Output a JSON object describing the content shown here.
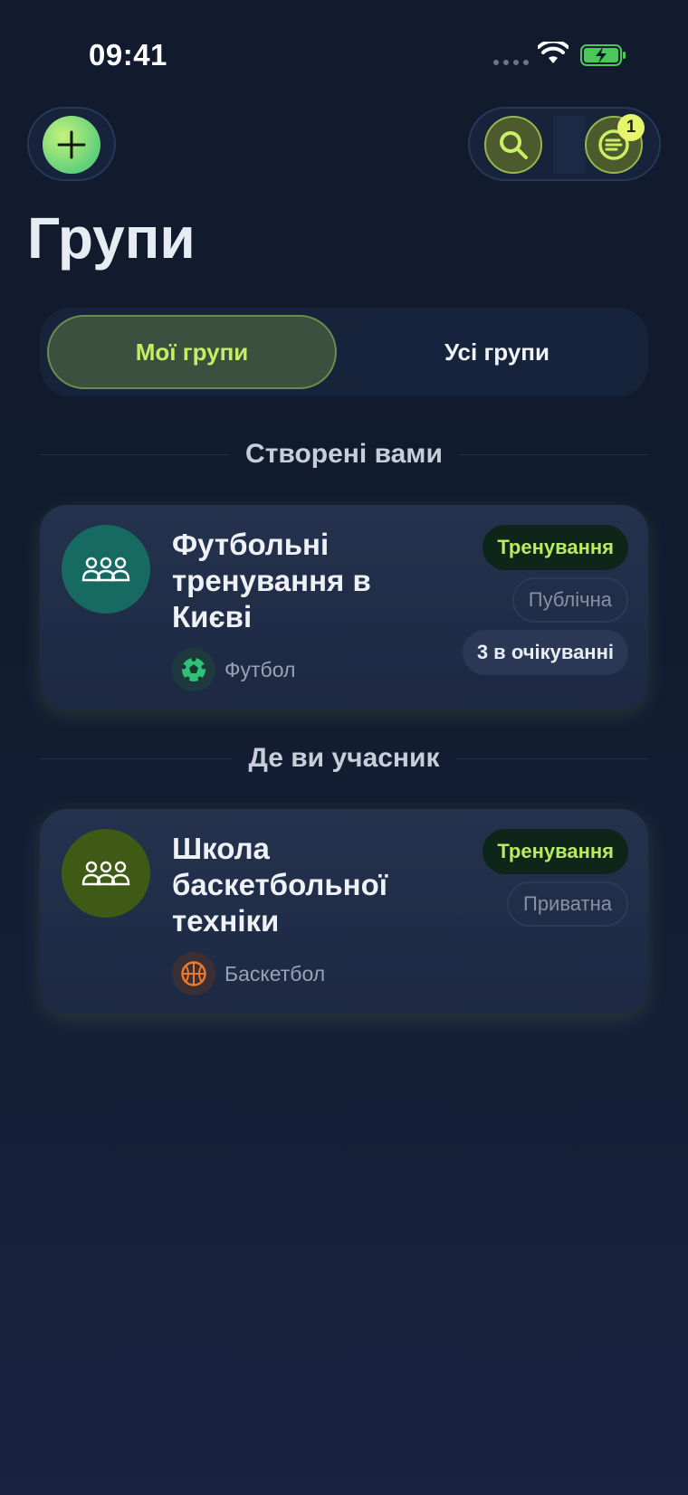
{
  "status_bar": {
    "time": "09:41"
  },
  "header": {
    "title": "Групи",
    "badge_count": "1"
  },
  "tabs": [
    {
      "label": "Мої групи",
      "active": true
    },
    {
      "label": "Усі групи",
      "active": false
    }
  ],
  "sections": [
    {
      "heading": "Створені вами",
      "card": {
        "title": "Футбольні тренування в Києві",
        "sport": "Футбол",
        "tags": {
          "type": "Тренування",
          "privacy": "Публічна",
          "pending": "3 в очікуванні"
        },
        "avatar_color": "#176a62"
      }
    },
    {
      "heading": "Де ви учасник",
      "card": {
        "title": "Школа баскетбольної техніки",
        "sport": "Баскетбол",
        "tags": {
          "type": "Тренування",
          "privacy": "Приватна"
        },
        "avatar_color": "#3e5a14"
      }
    }
  ],
  "colors": {
    "accent": "#c7ee63",
    "background": "#111c30"
  },
  "icons": [
    "plus-icon",
    "search-icon",
    "feed-icon",
    "group-icon",
    "soccer-ball-icon",
    "basketball-icon",
    "wifi-icon",
    "battery-icon"
  ]
}
